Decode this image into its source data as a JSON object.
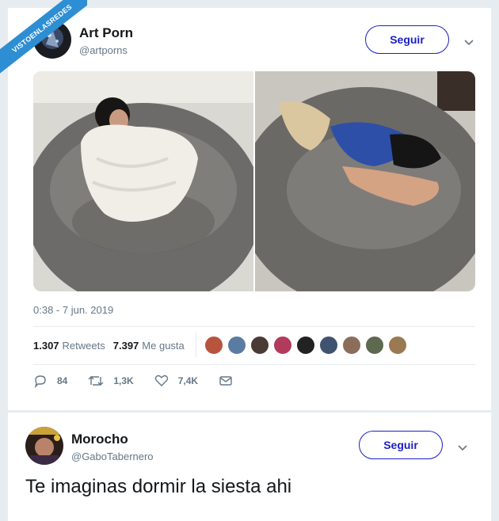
{
  "watermark": {
    "text": "VISTOENLASREDES"
  },
  "tweet": {
    "author_name": "Art Porn",
    "author_handle": "@artporns",
    "follow_label": "Seguir",
    "timestamp": "0:38 - 7 jun. 2019",
    "retweets_count": "1.307",
    "retweets_label": "Retweets",
    "likes_count": "7.397",
    "likes_label": "Me gusta",
    "actions": {
      "replies": "84",
      "retweets": "1,3K",
      "likes": "7,4K"
    },
    "media": [
      {
        "icon": "photo-girl-blanket-beanbag"
      },
      {
        "icon": "photo-girl-sleeping-beanbag"
      }
    ]
  },
  "reply": {
    "author_name": "Morocho",
    "author_handle": "@GaboTabernero",
    "follow_label": "Seguir",
    "text": "Te imaginas dormir la siesta ahi"
  },
  "colors": {
    "accent": "#1b1fc4",
    "badge": "#2d8ed3",
    "muted": "#657786"
  }
}
